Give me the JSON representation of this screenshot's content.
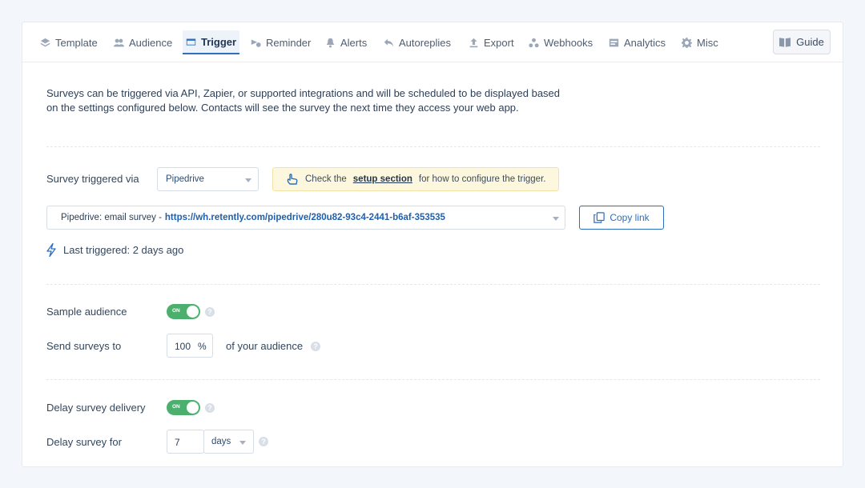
{
  "tabs": [
    {
      "label": "Template",
      "icon": "layers-icon"
    },
    {
      "label": "Audience",
      "icon": "users-icon"
    },
    {
      "label": "Trigger",
      "icon": "card-icon",
      "active": true
    },
    {
      "label": "Reminder",
      "icon": "reminder-icon"
    },
    {
      "label": "Alerts",
      "icon": "bell-icon"
    },
    {
      "label": "Autoreplies",
      "icon": "reply-icon"
    },
    {
      "label": "Export",
      "icon": "upload-icon"
    },
    {
      "label": "Webhooks",
      "icon": "webhooks-icon"
    },
    {
      "label": "Analytics",
      "icon": "analytics-icon"
    },
    {
      "label": "Misc",
      "icon": "gear-icon"
    }
  ],
  "guide_label": "Guide",
  "intro_text": "Surveys can be triggered via API, Zapier, or supported integrations and will be scheduled to be displayed based on the settings configured below. Contacts will see the survey the next time they access your web app.",
  "trigger": {
    "label": "Survey triggered via",
    "selected": "Pipedrive",
    "notice_prefix": "Check the",
    "notice_link": "setup section",
    "notice_suffix": "for how to configure the trigger.",
    "webhook_name": "Pipedrive: email survey -",
    "webhook_url": "https://wh.retently.com/pipedrive/280u82-93c4-2441-b6af-353535",
    "copy_label": "Copy link",
    "last_triggered": "Last triggered: 2 days ago"
  },
  "sample": {
    "label": "Sample audience",
    "toggle_text": "ON",
    "send_label": "Send surveys to",
    "percent_value": "100",
    "percent_unit": "%",
    "suffix": "of your audience"
  },
  "delay": {
    "label": "Delay survey delivery",
    "toggle_text": "ON",
    "delay_label": "Delay survey for",
    "value": "7",
    "unit": "days"
  },
  "colors": {
    "accent": "#2c6fbf",
    "toggle_on": "#4caf6e",
    "notice_bg": "#fdf7dd"
  }
}
